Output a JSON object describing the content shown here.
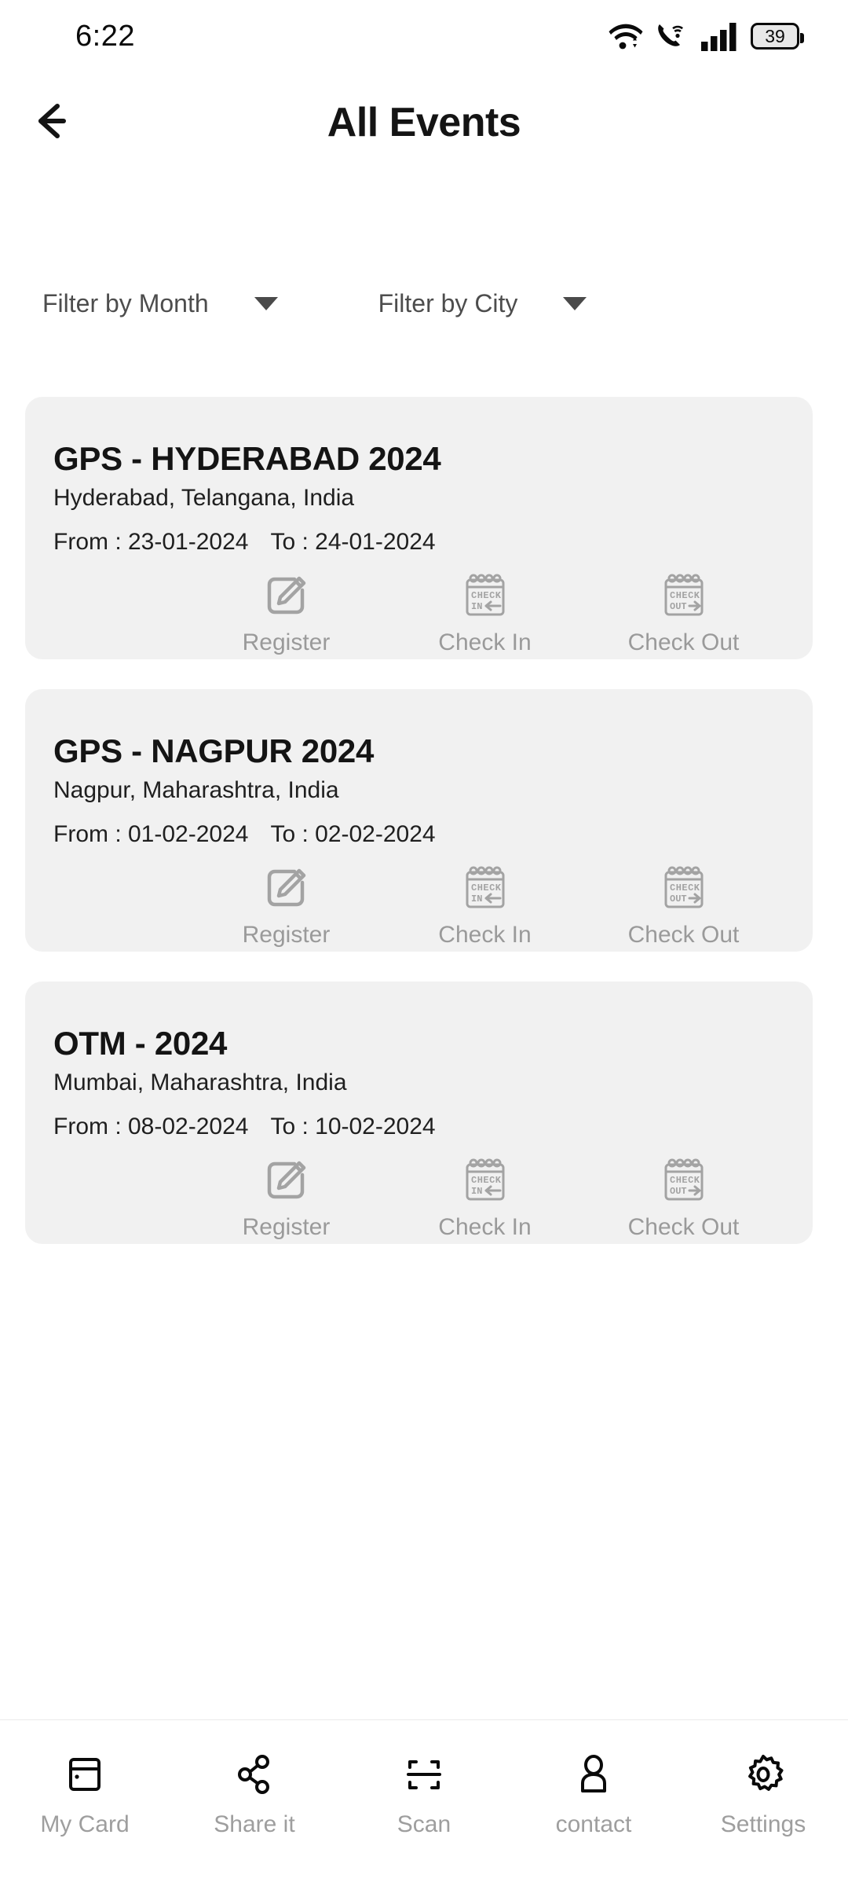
{
  "status_bar": {
    "time": "6:22",
    "icons": [
      "wifi-icon",
      "vowifi-call-icon",
      "cellular-signal-icon",
      "battery-icon"
    ],
    "battery_level": "39"
  },
  "app_bar": {
    "back_icon": "arrow-left-icon",
    "title": "All Events"
  },
  "filters": [
    {
      "label": "Filter by Month",
      "icon": "chevron-down-icon"
    },
    {
      "label": "Filter by City",
      "icon": "chevron-down-icon"
    }
  ],
  "colors": {
    "card_background": "#f1f1f1",
    "page_background": "#ffffff",
    "muted_text": "#9a9a9a",
    "primary_text": "#141414"
  },
  "events": [
    {
      "title": "GPS - HYDERABAD 2024",
      "location": "Hyderabad, Telangana, India",
      "from_label": "From : 23-01-2024",
      "to_label": "To : 24-01-2024",
      "actions": [
        {
          "label": "Register",
          "icon": "edit-square-icon"
        },
        {
          "label": "Check In",
          "icon": "check-in-calendar-icon"
        },
        {
          "label": "Check Out",
          "icon": "check-out-calendar-icon"
        }
      ]
    },
    {
      "title": "GPS - NAGPUR 2024",
      "location": "Nagpur, Maharashtra, India",
      "from_label": "From : 01-02-2024",
      "to_label": "To : 02-02-2024",
      "actions": [
        {
          "label": "Register",
          "icon": "edit-square-icon"
        },
        {
          "label": "Check In",
          "icon": "check-in-calendar-icon"
        },
        {
          "label": "Check Out",
          "icon": "check-out-calendar-icon"
        }
      ]
    },
    {
      "title": "OTM - 2024",
      "location": "Mumbai, Maharashtra, India",
      "from_label": "From : 08-02-2024",
      "to_label": "To : 10-02-2024",
      "actions": [
        {
          "label": "Register",
          "icon": "edit-square-icon"
        },
        {
          "label": "Check In",
          "icon": "check-in-calendar-icon"
        },
        {
          "label": "Check Out",
          "icon": "check-out-calendar-icon"
        }
      ]
    }
  ],
  "bottom_nav": [
    {
      "label": "My Card",
      "icon": "card-icon"
    },
    {
      "label": "Share it",
      "icon": "share-icon"
    },
    {
      "label": "Scan",
      "icon": "scan-icon"
    },
    {
      "label": "contact",
      "icon": "person-icon"
    },
    {
      "label": "Settings",
      "icon": "gear-icon"
    }
  ],
  "check_in_icon_text": {
    "line1": "CHECK",
    "line2": "IN"
  },
  "check_out_icon_text": {
    "line1": "CHECK",
    "line2": "OUT"
  }
}
